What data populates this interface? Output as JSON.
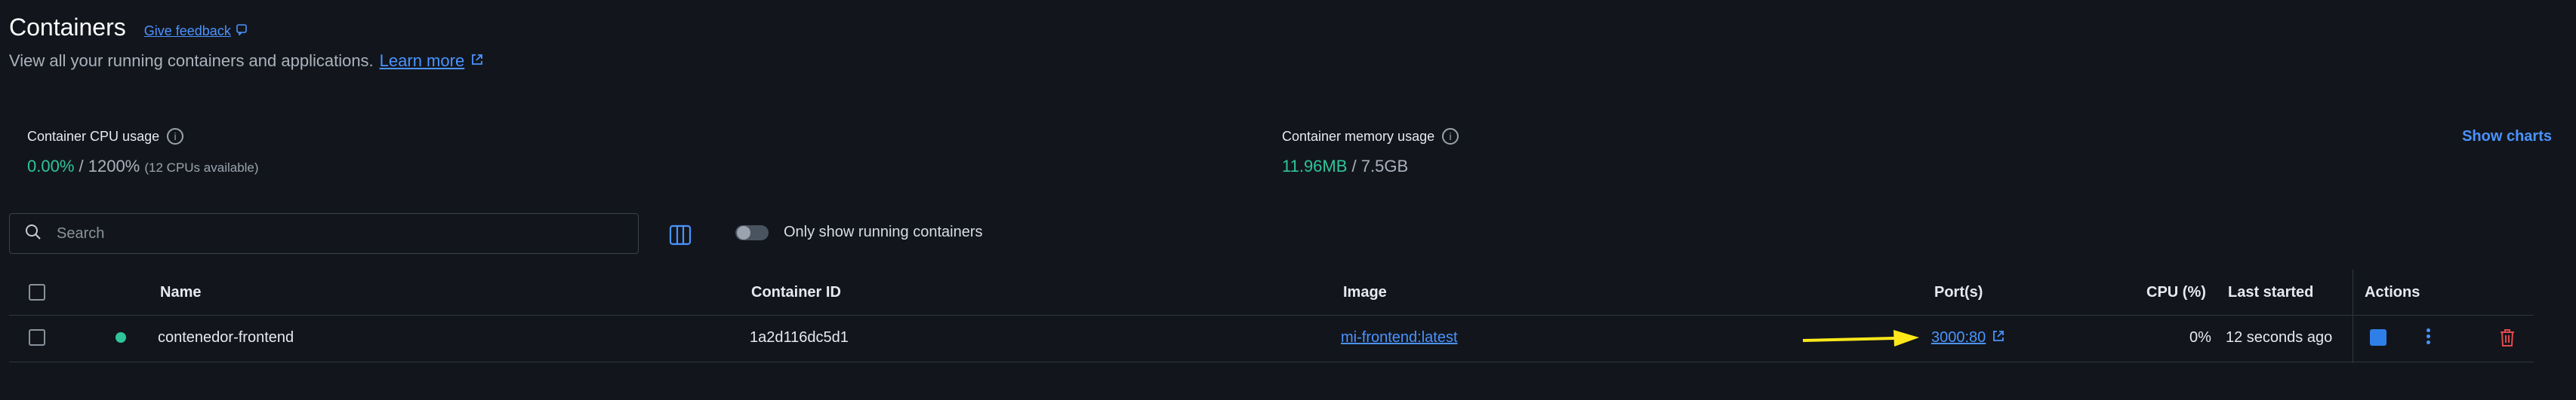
{
  "header": {
    "title": "Containers",
    "feedback_label": "Give feedback",
    "subtitle": "View all your running containers and applications.",
    "learn_more": "Learn more"
  },
  "stats": {
    "cpu": {
      "label": "Container CPU usage",
      "value": "0.00%",
      "total": "/ 1200%",
      "note": "(12 CPUs available)"
    },
    "memory": {
      "label": "Container memory usage",
      "value": "11.96MB",
      "total": "/ 7.5GB"
    },
    "show_charts": "Show charts"
  },
  "toolbar": {
    "search_placeholder": "Search",
    "toggle_label": "Only show running containers",
    "toggle_on": false
  },
  "table": {
    "headers": {
      "name": "Name",
      "container_id": "Container ID",
      "image": "Image",
      "ports": "Port(s)",
      "cpu": "CPU (%)",
      "last_started": "Last started",
      "actions": "Actions"
    },
    "rows": [
      {
        "name": "contenedor-frontend",
        "container_id": "1a2d116dc5d1",
        "image": "mi-frontend:latest",
        "ports": "3000:80",
        "cpu": "0%",
        "last_started": "12 seconds ago",
        "status": "running"
      }
    ]
  },
  "colors": {
    "accent": "#4b93ff",
    "running": "#2fc59a",
    "delete": "#e5484d",
    "annotation_arrow": "#ffe81a"
  }
}
